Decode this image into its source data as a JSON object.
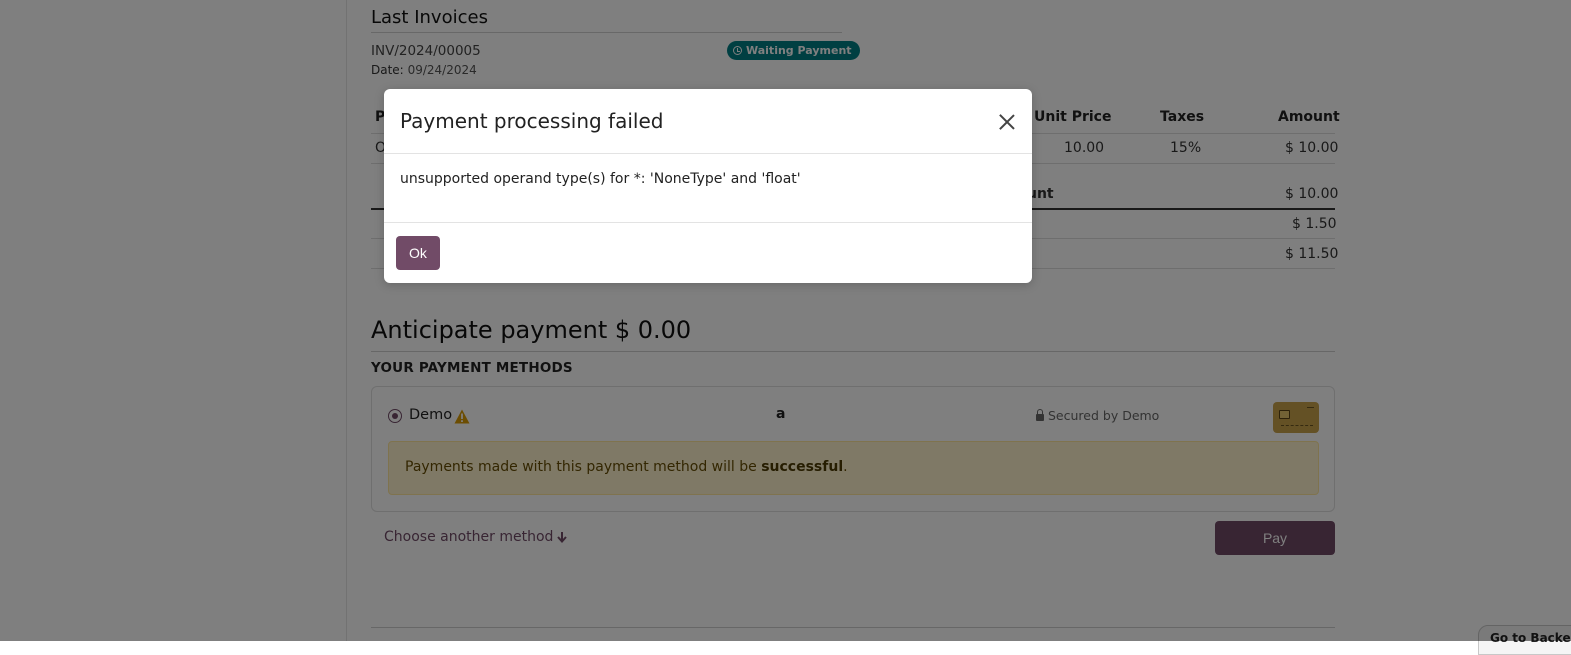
{
  "invoices": {
    "section_title": "Last Invoices",
    "number": "INV/2024/00005",
    "date_label": "Date:",
    "date_value": "09/24/2024",
    "status_badge": "Waiting Payment"
  },
  "lines_table": {
    "headers": [
      "P",
      "Unit Price",
      "Taxes",
      "Amount"
    ],
    "rows": [
      {
        "product": "O",
        "unit_price": "10.00",
        "taxes": "15%",
        "amount": "$ 10.00"
      }
    ],
    "untaxed_label_partial": "unt",
    "untaxed_amount": "$ 10.00",
    "tax_amount": "$ 1.50",
    "total_amount": "$ 11.50"
  },
  "payment": {
    "anticipate_title": "Anticipate payment $ 0.00",
    "methods_title": "YOUR PAYMENT METHODS",
    "method_name": "Demo",
    "method_extra": "a",
    "secured_text": "Secured by Demo",
    "notice_prefix": "Payments made with this payment method will be ",
    "notice_strong": "successful",
    "notice_suffix": ".",
    "choose_another": "Choose another method",
    "pay_label": "Pay"
  },
  "backend_button": "Go to Backend",
  "dialog": {
    "title": "Payment processing failed",
    "message": "unsupported operand type(s) for *: 'NoneType' and 'float'",
    "ok_label": "Ok"
  },
  "colors": {
    "primary": "#714b67",
    "badge": "#017e84",
    "notice_bg": "#fff3cd"
  }
}
